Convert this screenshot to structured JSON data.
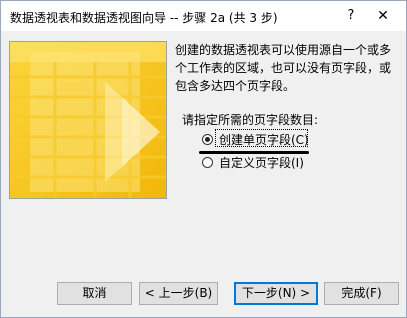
{
  "window": {
    "title": "数据透视表和数据透视图向导 -- 步骤 2a (共 3 步)",
    "help_label": "?",
    "close_label": "✕"
  },
  "content": {
    "description": "创建的数据透视表可以使用源自一个或多个工作表的区域，也可以没有页字段，或包含多达四个页字段。",
    "prompt": "请指定所需的页字段数目:",
    "options": [
      {
        "label": "创建单页字段(C)",
        "selected": true
      },
      {
        "label": "自定义页字段(I)",
        "selected": false
      }
    ]
  },
  "buttons": {
    "cancel": "取消",
    "back": "< 上一步(B)",
    "next": "下一步(N) >",
    "finish": "完成(F)"
  },
  "colors": {
    "accent": "#0078d7",
    "art_yellow": "#f6c21a"
  }
}
